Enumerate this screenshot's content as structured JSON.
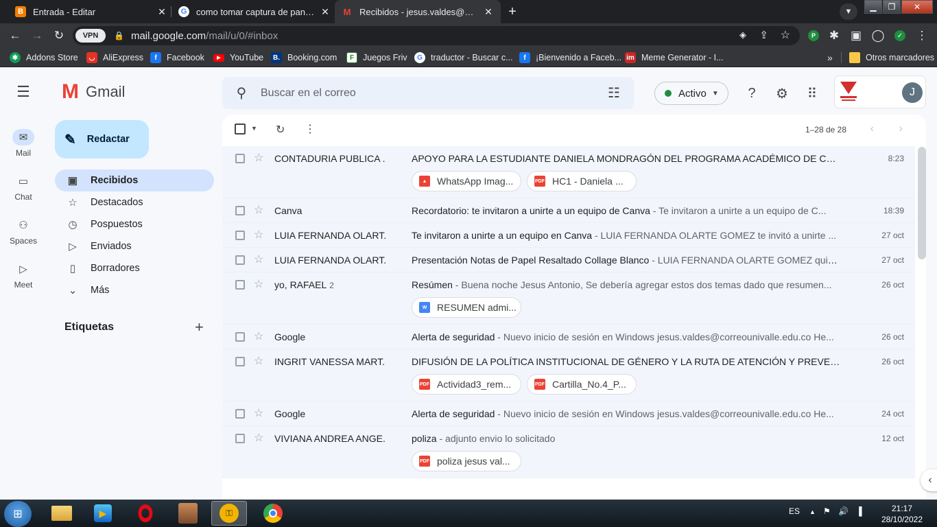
{
  "browser": {
    "tabs": [
      {
        "title": "Entrada - Editar",
        "icon": "blogger-icon"
      },
      {
        "title": "como tomar captura de pantalla",
        "icon": "google-icon"
      },
      {
        "title": "Recibidos - jesus.valdes@correounivalle.edu.co",
        "icon": "gmail-icon"
      }
    ],
    "new_tab": "+",
    "vpn_label": "VPN",
    "url_domain": "mail.google.com",
    "url_path": "/mail/u/0/#inbox",
    "bookmarks": [
      {
        "label": "Addons Store",
        "icon": "addons-icon",
        "color": "#0f9d58"
      },
      {
        "label": "AliExpress",
        "icon": "aliexpress-icon",
        "color": "#e43225"
      },
      {
        "label": "Facebook",
        "icon": "facebook-icon",
        "color": "#1877f2"
      },
      {
        "label": "YouTube",
        "icon": "youtube-icon",
        "color": "#ff0000"
      },
      {
        "label": "Booking.com",
        "icon": "booking-icon",
        "color": "#003580"
      },
      {
        "label": "Juegos Friv",
        "icon": "friv-icon",
        "color": "#2e7d32"
      },
      {
        "label": "traductor - Buscar c...",
        "icon": "google-icon",
        "color": "#ffffff"
      },
      {
        "label": "¡Bienvenido a Faceb...",
        "icon": "facebook-icon",
        "color": "#1877f2"
      },
      {
        "label": "Meme Generator - I...",
        "icon": "imgflip-icon",
        "color": "#c62828"
      }
    ],
    "more_bookmarks": "»",
    "other_bookmarks": "Otros marcadores"
  },
  "gmail": {
    "brand": "Gmail",
    "search_placeholder": "Buscar en el correo",
    "status": "Activo",
    "avatar_letter": "J",
    "compose": "Redactar",
    "rail": [
      {
        "label": "Mail",
        "icon": "mail-icon"
      },
      {
        "label": "Chat",
        "icon": "chat-icon"
      },
      {
        "label": "Spaces",
        "icon": "spaces-icon"
      },
      {
        "label": "Meet",
        "icon": "meet-icon"
      }
    ],
    "nav": [
      {
        "label": "Recibidos",
        "icon": "inbox-icon"
      },
      {
        "label": "Destacados",
        "icon": "star-icon"
      },
      {
        "label": "Pospuestos",
        "icon": "clock-icon"
      },
      {
        "label": "Enviados",
        "icon": "send-icon"
      },
      {
        "label": "Borradores",
        "icon": "draft-icon"
      },
      {
        "label": "Más",
        "icon": "chevron-down-icon"
      }
    ],
    "labels_heading": "Etiquetas",
    "pagination": "1–28 de 28",
    "emails": [
      {
        "sender": "CONTADURIA PUBLICA .",
        "count": "",
        "subject": "APOYO PARA LA ESTUDIANTE DANIELA MONDRAGÓN DEL PROGRAMA ACADÉMICO DE CONT...",
        "snippet": "",
        "date": "8:23",
        "attachments": [
          {
            "name": "WhatsApp Imag...",
            "type": "image"
          },
          {
            "name": "HC1 - Daniela ...",
            "type": "pdf"
          }
        ]
      },
      {
        "sender": "Canva",
        "count": "",
        "subject": "Recordatorio: te invitaron a unirte a un equipo de Canva",
        "snippet": " - Te invitaron a unirte a un equipo de C...",
        "date": "18:39",
        "attachments": []
      },
      {
        "sender": "LUIA FERNANDA OLART.",
        "count": "",
        "subject": "Te invitaron a unirte a un equipo en Canva",
        "snippet": " - LUIA FERNANDA OLARTE GOMEZ te invitó a unirte ...",
        "date": "27 oct",
        "attachments": []
      },
      {
        "sender": "LUIA FERNANDA OLART.",
        "count": "",
        "subject": "Presentación Notas de Papel Resaltado Collage Blanco",
        "snippet": " - LUIA FERNANDA OLARTE GOMEZ quie...",
        "date": "27 oct",
        "attachments": []
      },
      {
        "sender": "yo, RAFAEL",
        "count": "2",
        "subject": "Resúmen",
        "snippet": " - Buena noche Jesus Antonio, Se debería agregar estos dos temas dado que resumen...",
        "date": "26 oct",
        "attachments": [
          {
            "name": "RESUMEN admi...",
            "type": "word"
          }
        ]
      },
      {
        "sender": "Google",
        "count": "",
        "subject": "Alerta de seguridad",
        "snippet": " - Nuevo inicio de sesión en Windows jesus.valdes@correounivalle.edu.co He...",
        "date": "26 oct",
        "attachments": []
      },
      {
        "sender": "INGRIT VANESSA MART.",
        "count": "",
        "subject": "DIFUSIÓN DE LA POLÍTICA INSTITUCIONAL DE GÉNERO Y LA RUTA DE ATENCIÓN Y PREVENCI...",
        "snippet": "",
        "date": "26 oct",
        "attachments": [
          {
            "name": "Actividad3_rem...",
            "type": "pdf"
          },
          {
            "name": "Cartilla_No.4_P...",
            "type": "pdf"
          }
        ]
      },
      {
        "sender": "Google",
        "count": "",
        "subject": "Alerta de seguridad",
        "snippet": " - Nuevo inicio de sesión en Windows jesus.valdes@correounivalle.edu.co He...",
        "date": "24 oct",
        "attachments": []
      },
      {
        "sender": "VIVIANA ANDREA ANGE.",
        "count": "",
        "subject": "poliza",
        "snippet": " - adjunto envio lo solicitado",
        "date": "12 oct",
        "attachments": [
          {
            "name": "poliza jesus val...",
            "type": "pdf"
          }
        ]
      }
    ]
  },
  "taskbar": {
    "language": "ES",
    "time": "21:17",
    "date": "28/10/2022"
  },
  "colors": {
    "accent": "#0b57d0",
    "compose_bg": "#c2e7ff",
    "selected_nav": "#d3e3fd",
    "pdf": "#ea4335",
    "image": "#ea4335",
    "word": "#4285f4"
  }
}
